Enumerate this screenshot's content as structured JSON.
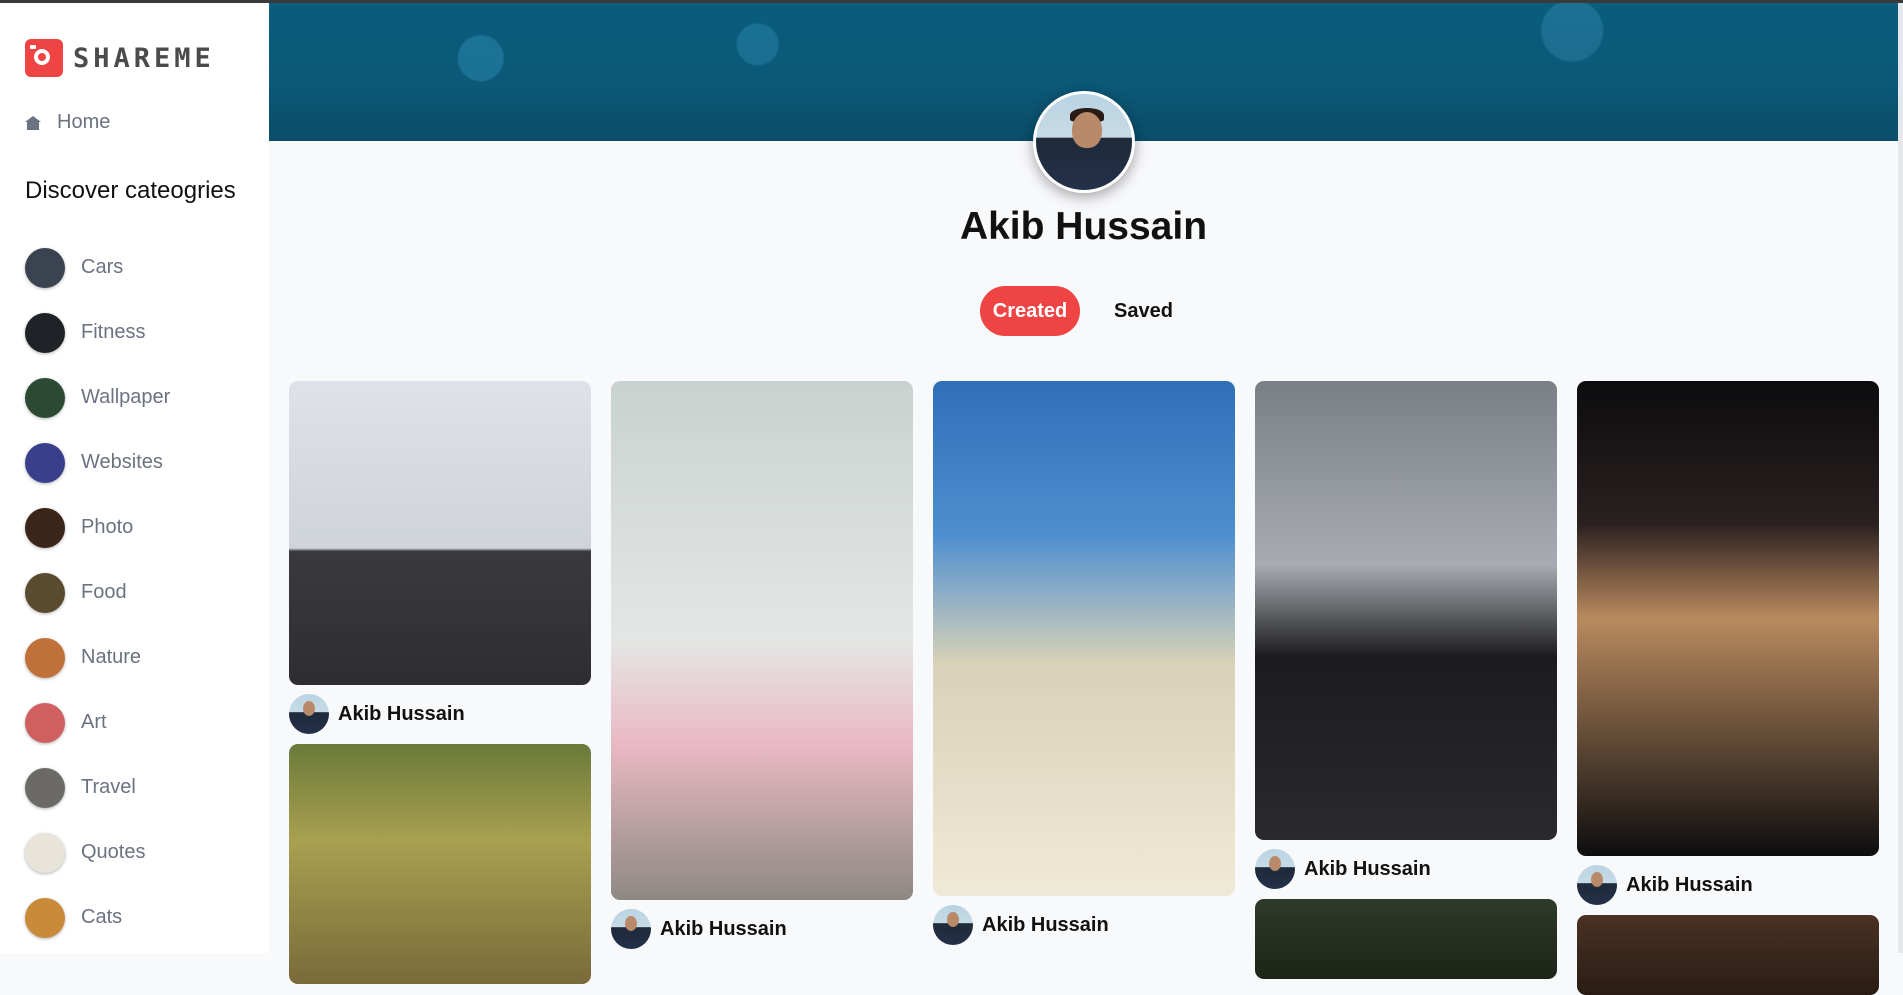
{
  "app": {
    "logo_text": "SHAREME"
  },
  "sidebar": {
    "home_label": "Home",
    "discover_title": "Discover cateogries",
    "categories": [
      {
        "label": "Cars",
        "color": "#3b4250"
      },
      {
        "label": "Fitness",
        "color": "#1f2226"
      },
      {
        "label": "Wallpaper",
        "color": "#2c4a33"
      },
      {
        "label": "Websites",
        "color": "#3a3f8c"
      },
      {
        "label": "Photo",
        "color": "#3b2418"
      },
      {
        "label": "Food",
        "color": "#5a4a2e"
      },
      {
        "label": "Nature",
        "color": "#c0713a"
      },
      {
        "label": "Art",
        "color": "#d06060"
      },
      {
        "label": "Travel",
        "color": "#6b6a66"
      },
      {
        "label": "Quotes",
        "color": "#e8e4da"
      },
      {
        "label": "Cats",
        "color": "#c98b3a"
      }
    ]
  },
  "profile": {
    "name": "Akib Hussain",
    "tabs": [
      {
        "label": "Created",
        "active": true
      },
      {
        "label": "Saved",
        "active": false
      }
    ]
  },
  "pins": {
    "col1": [
      {
        "author": "Akib Hussain",
        "bg": "linear-gradient(180deg,#dfe2e8 0%,#cfd3da 55%,#3a3a3e 56%,#2e2e32 100%)"
      },
      {
        "author": "",
        "bg": "linear-gradient(180deg,#6a7a3a 0%,#a8a050 40%,#7a6a3a 100%)"
      }
    ],
    "col2": [
      {
        "author": "Akib Hussain",
        "bg": "linear-gradient(180deg,#c9d2d0 0%,#e4e6e4 50%,#e9b9c4 70%,#8d8882 100%)"
      }
    ],
    "col3": [
      {
        "author": "Akib Hussain",
        "bg": "linear-gradient(180deg,#2f6fb8 0%,#4e8fd0 30%,#d9d2b8 55%,#efe9d7 100%)"
      }
    ],
    "col4": [
      {
        "author": "Akib Hussain",
        "bg": "linear-gradient(180deg,#7a7f86 0%,#a8acb2 40%,#1c1c1e 60%,#2a2a2c 100%)"
      },
      {
        "author": "",
        "bg": "linear-gradient(180deg,#2f3a2a 0%,#1d2418 100%)"
      }
    ],
    "col5": [
      {
        "author": "Akib Hussain",
        "bg": "linear-gradient(180deg,#0c0c0e 0%,#2a2020 30%,#b98a5e 50%,#0d0d0f 100%)"
      },
      {
        "author": "",
        "bg": "linear-gradient(180deg,#4a3224 0%,#2a1c14 100%)"
      }
    ]
  }
}
